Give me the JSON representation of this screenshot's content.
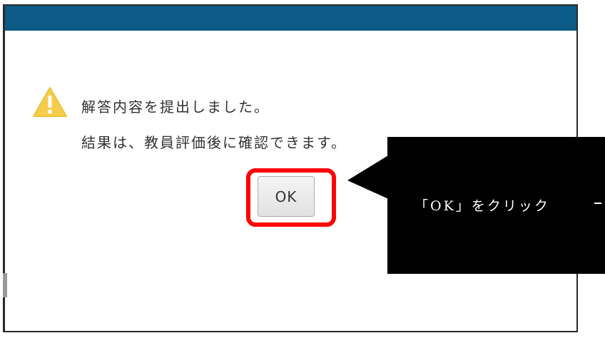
{
  "dialog": {
    "message_line1": "解答内容を提出しました。",
    "message_line2": "結果は、教員評価後に確認できます。",
    "ok_label": "OK",
    "icon": "warning-icon",
    "titlebar_color": "#0b5b86"
  },
  "annotation": {
    "callout_text": "「OK」をクリック",
    "highlight_color": "#ff0000"
  }
}
